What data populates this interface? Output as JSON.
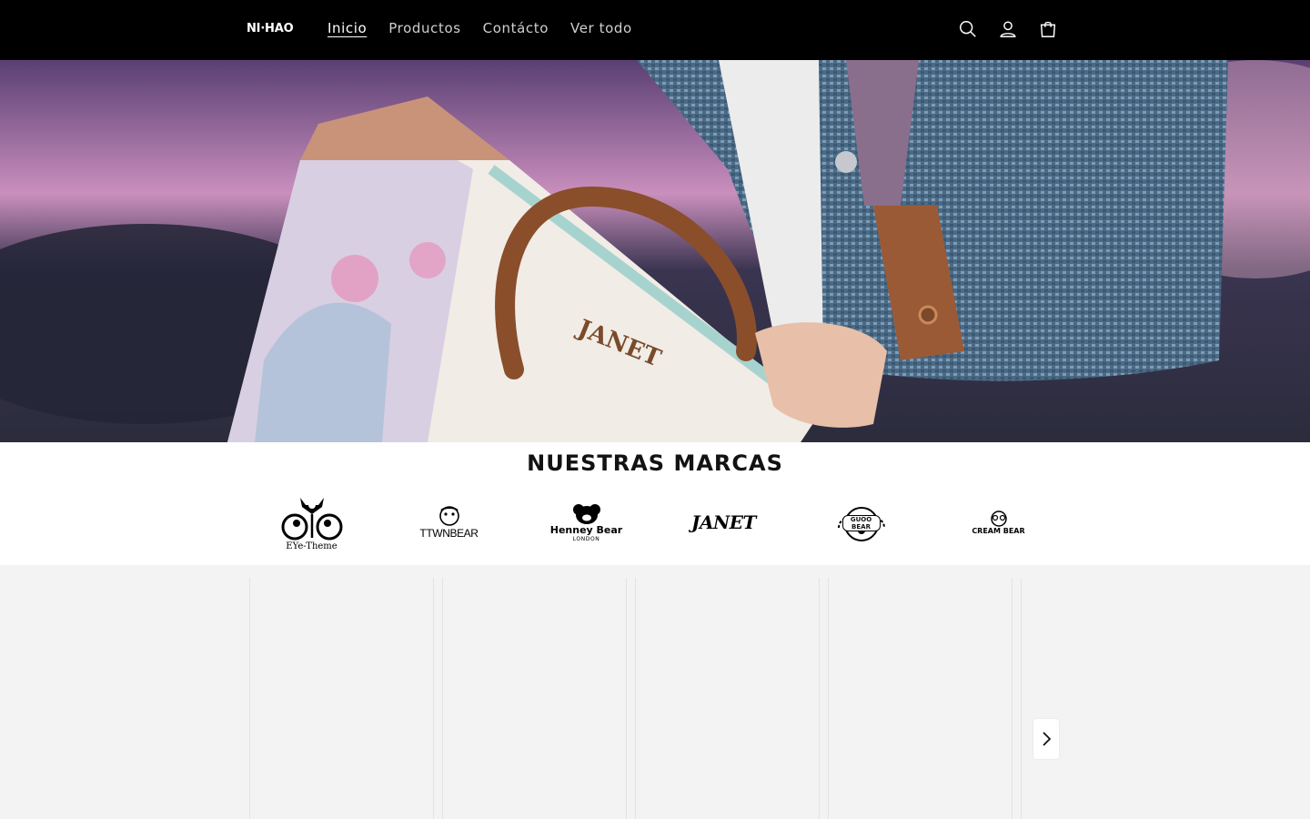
{
  "header": {
    "logo": "NI·HAO",
    "nav": [
      {
        "label": "Inicio",
        "active": true
      },
      {
        "label": "Productos",
        "active": false
      },
      {
        "label": "Contácto",
        "active": false
      },
      {
        "label": "Ver todo",
        "active": false
      }
    ],
    "icons": [
      "search-icon",
      "account-icon",
      "cart-icon"
    ]
  },
  "hero": {
    "bag_brand": "JANET",
    "strap_text": "JANET"
  },
  "brands": {
    "title": "NUESTRAS MARCAS",
    "items": [
      {
        "name": "EYe-Theme"
      },
      {
        "name": "TTWNBEAR"
      },
      {
        "name": "Henney Bear",
        "sub": "LONDON"
      },
      {
        "name": "JANET"
      },
      {
        "name": "GUOO BEAR"
      },
      {
        "name": "CREAM BEAR"
      }
    ]
  },
  "colors": {
    "header_bg": "#000000",
    "product_bg": "#f3f3f3",
    "text": "#121212"
  }
}
